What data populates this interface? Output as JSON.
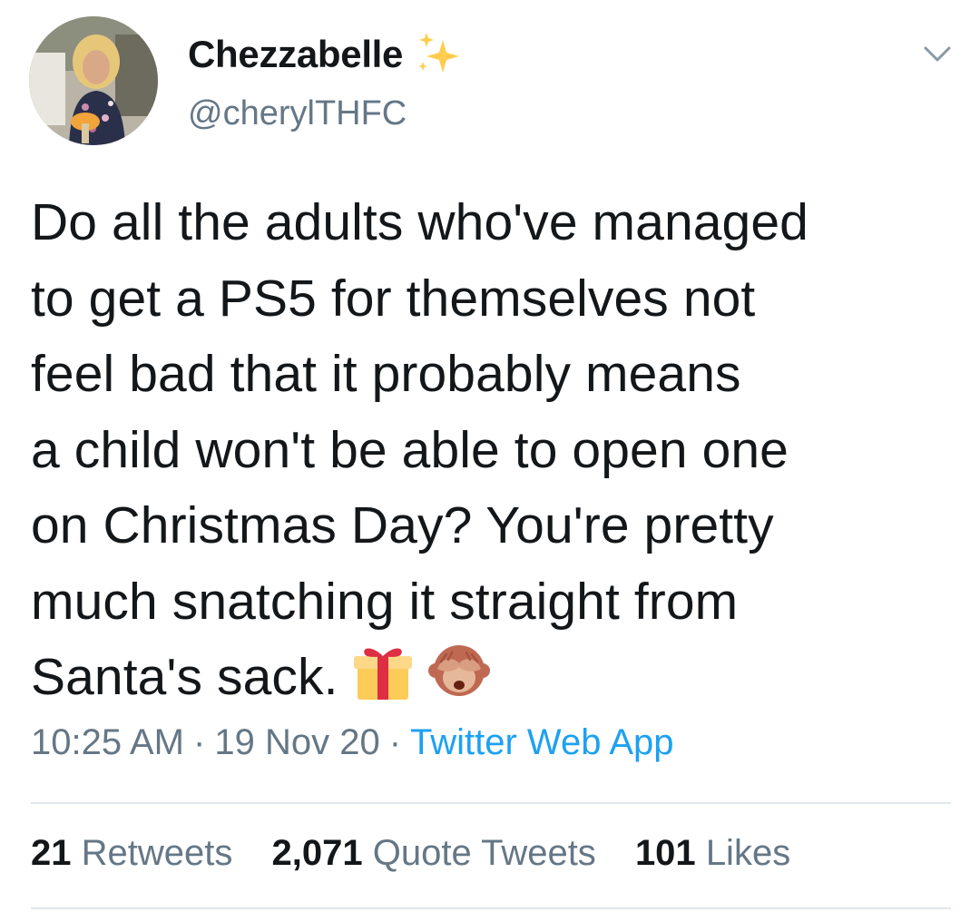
{
  "user": {
    "display_name": "Chezzabelle",
    "name_emoji": "sparkles-icon",
    "handle": "@cherylTHFC"
  },
  "tweet": {
    "lines": [
      "Do all the adults who've managed",
      "to get a PS5 for themselves not",
      "feel bad that it probably means",
      "a child won't be able to open one",
      "on Christmas Day? You're pretty",
      "much snatching it straight from",
      "Santa's sack."
    ],
    "trailing_emoji": [
      "wrapped-gift-icon",
      "see-no-evil-monkey-icon"
    ]
  },
  "meta": {
    "time": "10:25 AM",
    "separator": "·",
    "date": "19 Nov 20",
    "source": "Twitter Web App"
  },
  "stats": {
    "retweets_count": "21",
    "retweets_label": "Retweets",
    "quotes_count": "2,071",
    "quotes_label": "Quote Tweets",
    "likes_count": "101",
    "likes_label": "Likes"
  },
  "colors": {
    "text": "#14171a",
    "secondary": "#657786",
    "link": "#1da1f2",
    "divider": "#e1e8ed"
  }
}
